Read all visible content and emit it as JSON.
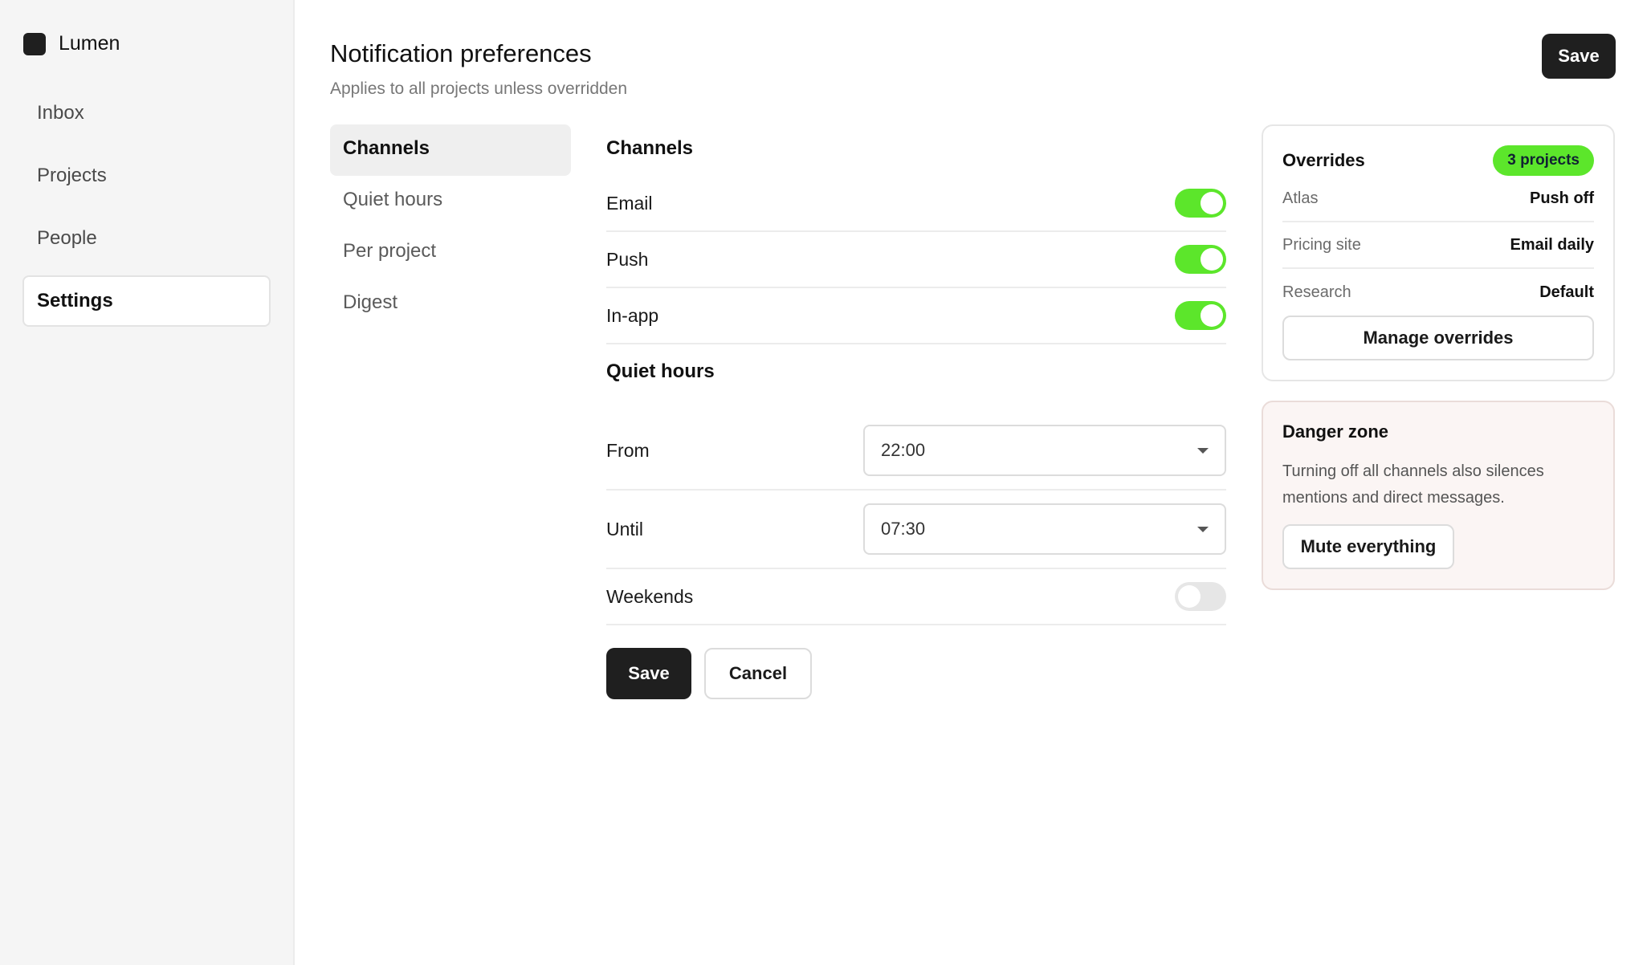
{
  "sidebar": {
    "brand": "Lumen",
    "items": [
      {
        "label": "Inbox"
      },
      {
        "label": "Projects"
      },
      {
        "label": "People"
      },
      {
        "label": "Settings"
      }
    ],
    "active": "Settings"
  },
  "header": {
    "title": "Notification preferences",
    "subtitle": "Applies to all projects unless overridden",
    "save_label": "Save"
  },
  "section_nav": {
    "items": [
      {
        "label": "Channels"
      },
      {
        "label": "Quiet hours"
      },
      {
        "label": "Per project"
      },
      {
        "label": "Digest"
      }
    ],
    "active": "Channels"
  },
  "channels": {
    "title": "Channels",
    "rows": [
      {
        "label": "Email",
        "enabled": true
      },
      {
        "label": "Push",
        "enabled": true
      },
      {
        "label": "In-app",
        "enabled": true
      }
    ]
  },
  "quiet_hours": {
    "title": "Quiet hours",
    "from_label": "From",
    "from_value": "22:00",
    "until_label": "Until",
    "until_value": "07:30",
    "weekends_label": "Weekends",
    "weekends_enabled": false
  },
  "form_actions": {
    "save_label": "Save",
    "cancel_label": "Cancel"
  },
  "overrides": {
    "title": "Overrides",
    "badge": "3 projects",
    "rows": [
      {
        "name": "Atlas",
        "value": "Push off"
      },
      {
        "name": "Pricing site",
        "value": "Email daily"
      },
      {
        "name": "Research",
        "value": "Default"
      }
    ],
    "manage_label": "Manage overrides"
  },
  "danger_zone": {
    "title": "Danger zone",
    "text": "Turning off all channels also silences mentions and direct messages.",
    "button_label": "Mute everything"
  },
  "colors": {
    "accent": "#5ce62b",
    "dark_button": "#1f1f1f"
  }
}
